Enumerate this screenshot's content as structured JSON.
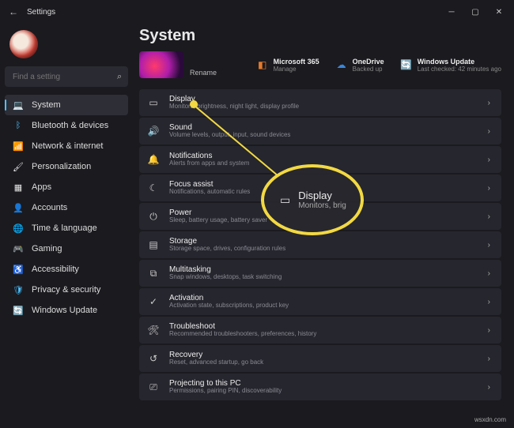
{
  "titlebar": {
    "title": "Settings"
  },
  "search": {
    "placeholder": "Find a setting"
  },
  "sidebar": {
    "items": [
      {
        "label": "System",
        "icon": "💻",
        "active": true
      },
      {
        "label": "Bluetooth & devices",
        "icon": "ᛒ",
        "color": "#4cc2ff"
      },
      {
        "label": "Network & internet",
        "icon": "📶",
        "color": "#4cc2ff"
      },
      {
        "label": "Personalization",
        "icon": "🖌",
        "color": "#e8e8e8"
      },
      {
        "label": "Apps",
        "icon": "▦",
        "color": "#e8e8e8"
      },
      {
        "label": "Accounts",
        "icon": "👤",
        "color": "#e8e8e8"
      },
      {
        "label": "Time & language",
        "icon": "🌐",
        "color": "#4cc2ff"
      },
      {
        "label": "Gaming",
        "icon": "🎮",
        "color": "#e8e8e8"
      },
      {
        "label": "Accessibility",
        "icon": "♿",
        "color": "#4cc2ff"
      },
      {
        "label": "Privacy & security",
        "icon": "🛡",
        "color": "#4cc2ff"
      },
      {
        "label": "Windows Update",
        "icon": "🔄",
        "color": "#4cc2ff"
      }
    ]
  },
  "main": {
    "title": "System",
    "rename": "Rename",
    "services": [
      {
        "title": "Microsoft 365",
        "sub": "Manage",
        "icon": "◧",
        "color": "#e67a2a"
      },
      {
        "title": "OneDrive",
        "sub": "Backed up",
        "icon": "☁",
        "color": "#3a86d8"
      },
      {
        "title": "Windows Update",
        "sub": "Last checked: 42 minutes ago",
        "icon": "🔄",
        "color": "#2aa8c8"
      }
    ],
    "rows": [
      {
        "title": "Display",
        "sub": "Monitors, brightness, night light, display profile",
        "icon": "▭"
      },
      {
        "title": "Sound",
        "sub": "Volume levels, output, input, sound devices",
        "icon": "🔊"
      },
      {
        "title": "Notifications",
        "sub": "Alerts from apps and system",
        "icon": "🔔"
      },
      {
        "title": "Focus assist",
        "sub": "Notifications, automatic rules",
        "icon": "☾"
      },
      {
        "title": "Power",
        "sub": "Sleep, battery usage, battery saver",
        "icon": "⏻"
      },
      {
        "title": "Storage",
        "sub": "Storage space, drives, configuration rules",
        "icon": "▤"
      },
      {
        "title": "Multitasking",
        "sub": "Snap windows, desktops, task switching",
        "icon": "⧉"
      },
      {
        "title": "Activation",
        "sub": "Activation state, subscriptions, product key",
        "icon": "✓"
      },
      {
        "title": "Troubleshoot",
        "sub": "Recommended troubleshooters, preferences, history",
        "icon": "🛠"
      },
      {
        "title": "Recovery",
        "sub": "Reset, advanced startup, go back",
        "icon": "↺"
      },
      {
        "title": "Projecting to this PC",
        "sub": "Permissions, pairing PIN, discoverability",
        "icon": "⎚"
      }
    ]
  },
  "callout": {
    "title": "Display",
    "sub": "Monitors, brig"
  },
  "attribution": "wsxdn.com"
}
